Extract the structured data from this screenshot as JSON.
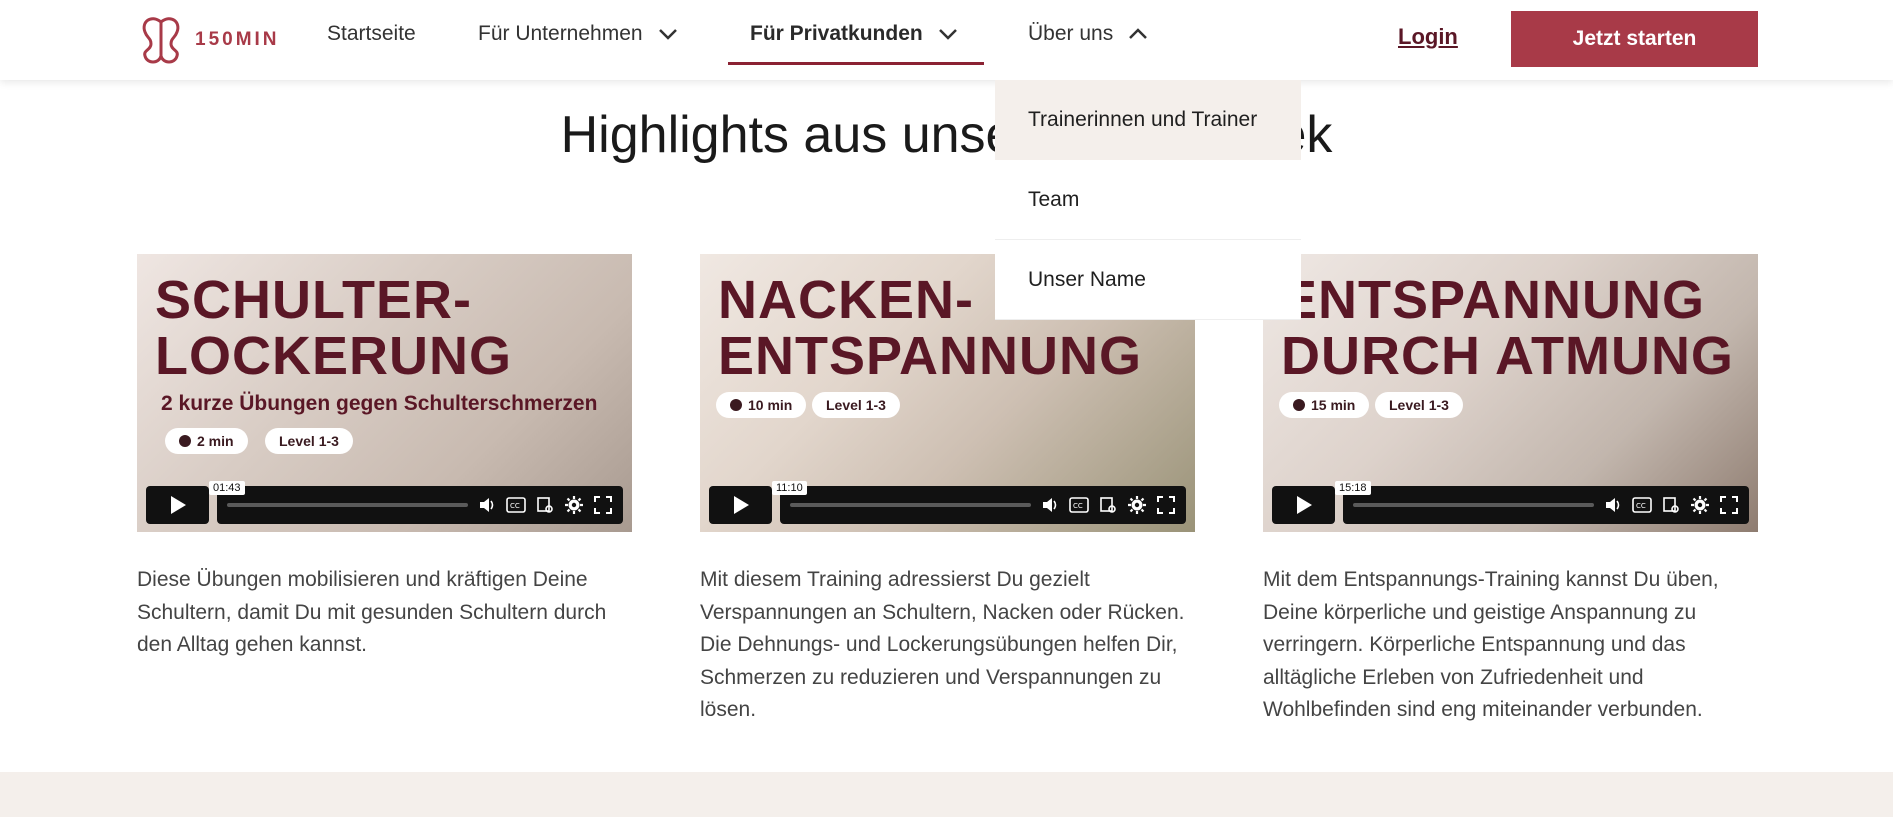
{
  "header": {
    "logo_text": "150MIN",
    "nav": [
      {
        "label": "Startseite"
      },
      {
        "label": "Für Unternehmen"
      },
      {
        "label": "Für Privatkunden"
      },
      {
        "label": "Über uns"
      }
    ],
    "login_label": "Login",
    "cta_label": "Jetzt starten"
  },
  "dropdown": {
    "items": [
      {
        "label": "Trainerinnen und Trainer"
      },
      {
        "label": "Team"
      },
      {
        "label": "Unser Name"
      }
    ]
  },
  "section": {
    "title": "Highlights aus unserer Mediathek"
  },
  "videos": [
    {
      "title": "SCHULTER-\nLOCKERUNG",
      "subtitle": "2 kurze Übungen gegen Schulterschmerzen",
      "duration_badge": "2 min",
      "level_badge": "Level 1-3",
      "time_tooltip": "01:43",
      "description": "Diese Übungen mobilisieren und kräftigen Deine Schultern, damit Du mit gesunden Schultern durch den Alltag gehen kannst."
    },
    {
      "title": "NACKEN-\nENTSPANNUNG",
      "subtitle": "",
      "duration_badge": "10 min",
      "level_badge": "Level 1-3",
      "time_tooltip": "11:10",
      "description": "Mit diesem Training adressierst Du gezielt Verspannungen an Schultern, Nacken oder Rücken. Die Dehnungs- und Lockerungsübungen helfen Dir, Schmerzen zu reduzieren und Verspannungen zu lösen."
    },
    {
      "title": "ENTSPANNUNG\nDURCH ATMUNG",
      "subtitle": "",
      "duration_badge": "15 min",
      "level_badge": "Level 1-3",
      "time_tooltip": "15:18",
      "description": "Mit dem Entspannungs-Training kannst Du üben, Deine körperliche und geistige Anspannung zu verringern. Körperliche Entspannung und das alltägliche Erleben von Zufriedenheit und Wohlbefinden sind eng miteinander verbunden."
    }
  ],
  "colors": {
    "brand": "#a83a48",
    "brand_dark": "#5a1726",
    "band": "#f4efeb"
  }
}
